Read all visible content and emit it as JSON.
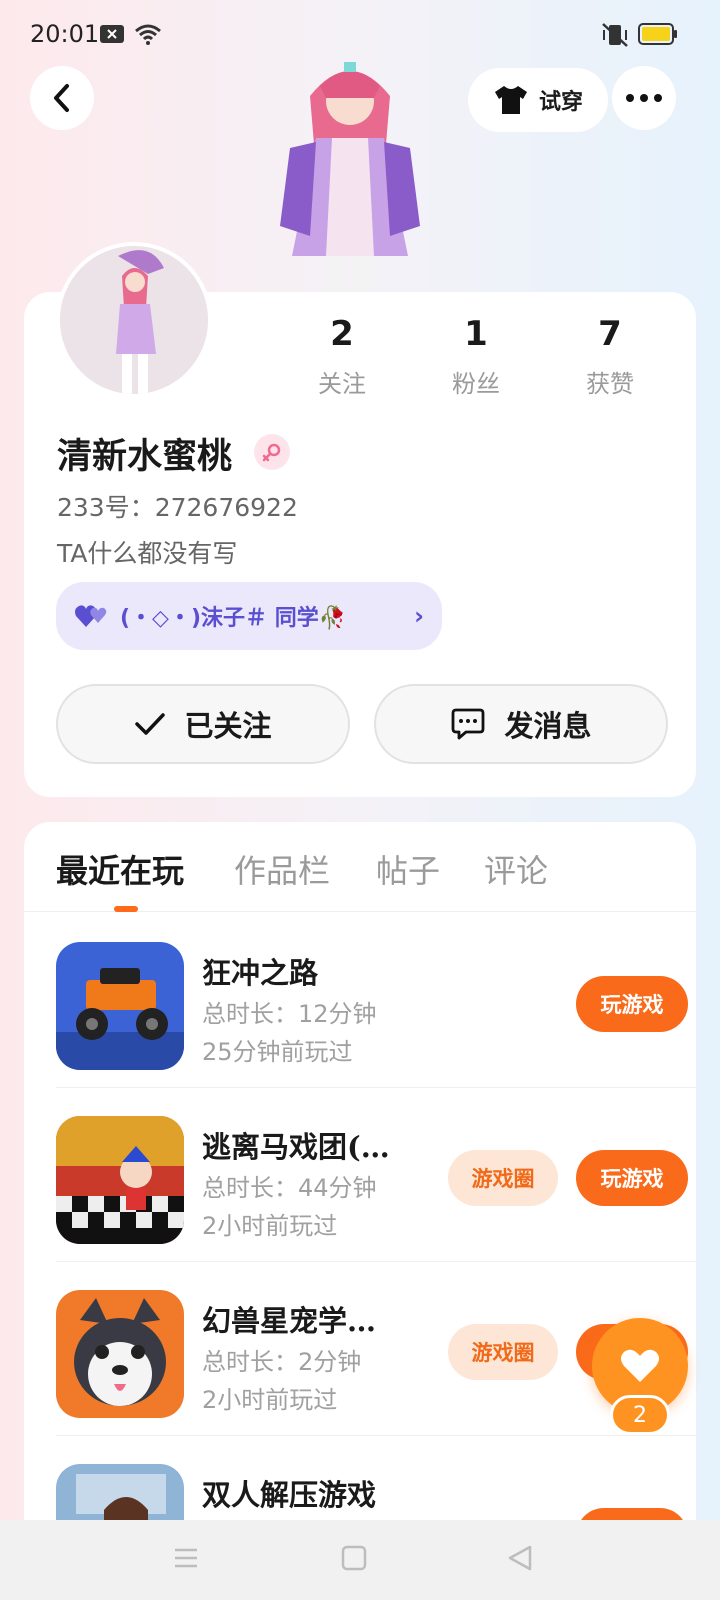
{
  "status_bar": {
    "time": "20:01"
  },
  "header": {
    "try_on_label": "试穿"
  },
  "profile": {
    "stats": [
      {
        "value": "2",
        "label": "关注"
      },
      {
        "value": "1",
        "label": "粉丝"
      },
      {
        "value": "7",
        "label": "获赞"
      }
    ],
    "name": "清新水蜜桃",
    "uid_text": "233号：272676922",
    "bio": "TA什么都没有写",
    "friend_tag": "(・◇・)沫子＃ 同学🥀",
    "follow_label": "已关注",
    "message_label": "发消息"
  },
  "tabs": [
    {
      "label": "最近在玩",
      "active": true
    },
    {
      "label": "作品栏",
      "active": false
    },
    {
      "label": "帖子",
      "active": false
    },
    {
      "label": "评论",
      "active": false
    }
  ],
  "games": [
    {
      "name": "狂冲之路",
      "duration": "总时长：12分钟",
      "last_played": "25分钟前玩过",
      "circle_label": "",
      "play_label": "玩游戏"
    },
    {
      "name": "逃离马戏团(…",
      "duration": "总时长：44分钟",
      "last_played": "2小时前玩过",
      "circle_label": "游戏圈",
      "play_label": "玩游戏"
    },
    {
      "name": "幻兽星宠学…",
      "duration": "总时长：2分钟",
      "last_played": "2小时前玩过",
      "circle_label": "游戏圈",
      "play_label": "玩游戏"
    },
    {
      "name": "双人解压游戏",
      "duration": "",
      "last_played": "",
      "circle_label": "",
      "play_label": ""
    }
  ],
  "like_fab": {
    "count": "2"
  },
  "colors": {
    "accent": "#f96a1a",
    "fab": "#ff9321",
    "tag_bg": "#ece8fb",
    "tag_text": "#5a4fd0"
  }
}
